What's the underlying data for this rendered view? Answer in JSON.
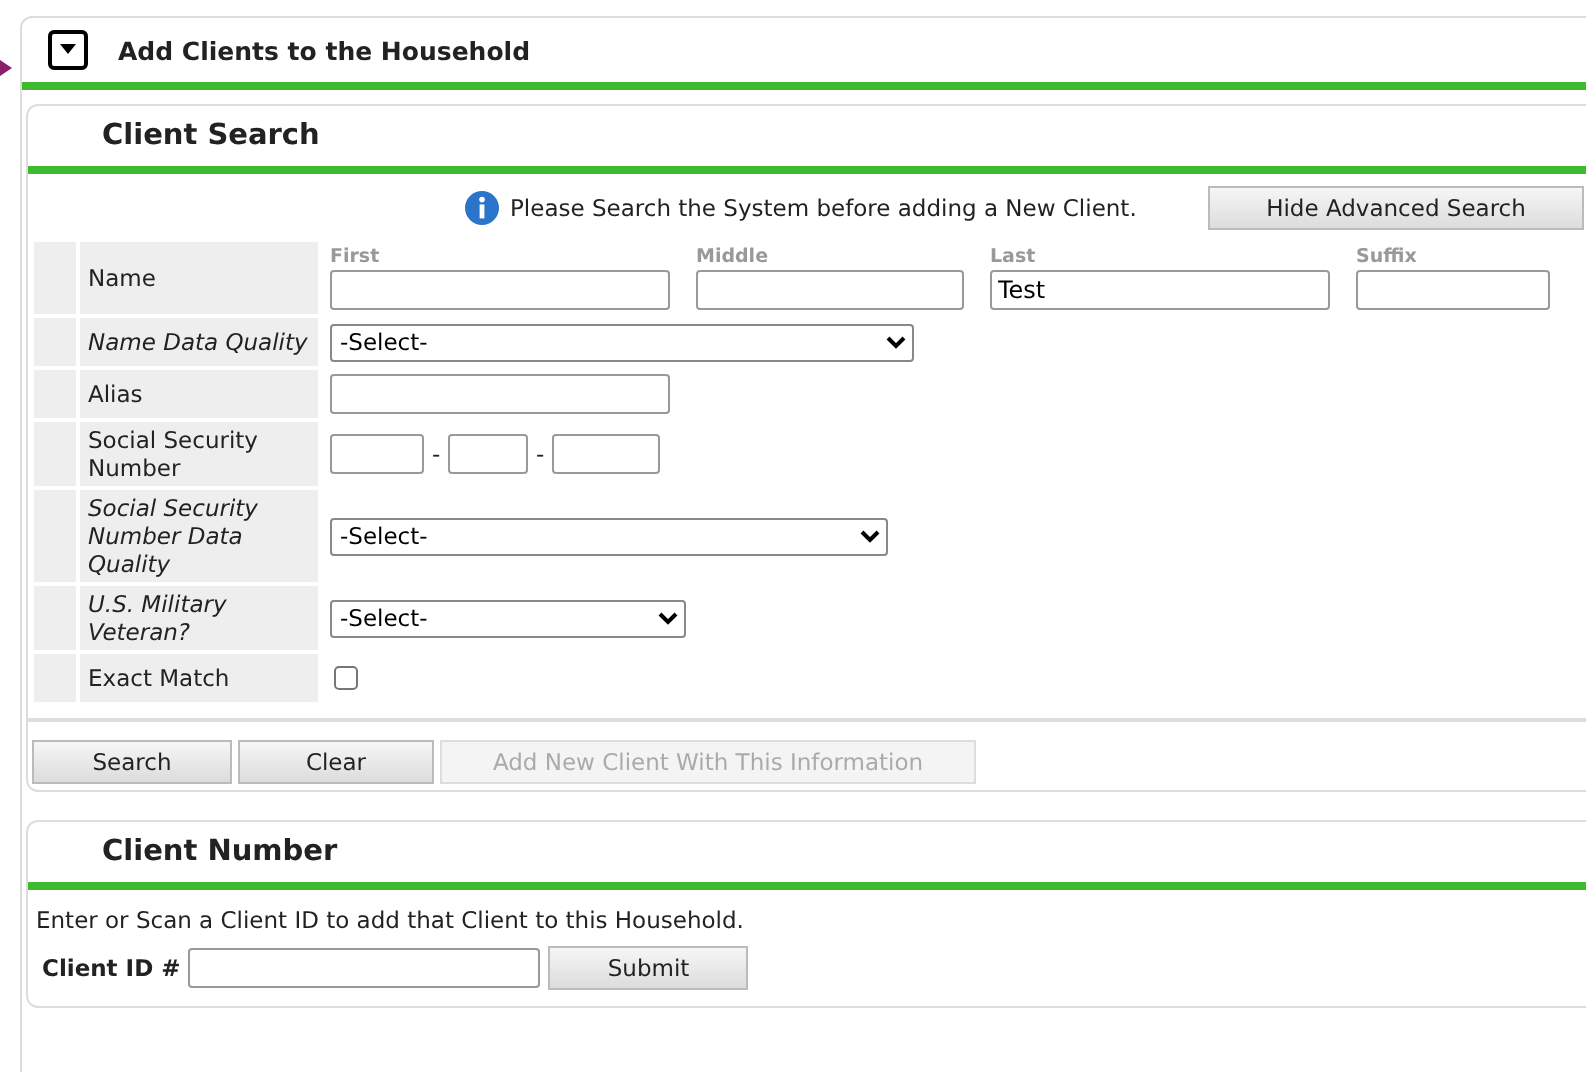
{
  "section": {
    "title": "Add Clients to the Household",
    "expanded": true
  },
  "client_search": {
    "title": "Client Search",
    "notice": "Please Search the System before adding a New Client.",
    "toggle_button": "Hide Advanced Search",
    "rows": [
      {
        "kind": "name",
        "label": "Name",
        "italic": false,
        "parts": [
          {
            "caption": "First"
          },
          {
            "caption": "Middle"
          },
          {
            "caption": "Last",
            "value": "Test"
          },
          {
            "caption": "Suffix"
          }
        ]
      },
      {
        "kind": "select",
        "label": "Name Data Quality",
        "italic": true,
        "value": "-Select-"
      },
      {
        "kind": "text",
        "label": "Alias",
        "italic": false
      },
      {
        "kind": "ssn",
        "label": "Social Security Number",
        "italic": false,
        "separator": "-"
      },
      {
        "kind": "select",
        "label": "Social Security Number Data Quality",
        "italic": true,
        "value": "-Select-"
      },
      {
        "kind": "select",
        "label": "U.S. Military Veteran?",
        "italic": true,
        "value": "-Select-"
      },
      {
        "kind": "checkbox",
        "label": "Exact Match",
        "italic": false,
        "checked": false
      }
    ],
    "buttons": [
      {
        "label": "Search",
        "disabled": false
      },
      {
        "label": "Clear",
        "disabled": false
      },
      {
        "label": "Add New Client With This Information",
        "disabled": true
      }
    ]
  },
  "client_number": {
    "title": "Client Number",
    "instructions": "Enter or Scan a Client ID to add that Client to this Household.",
    "field_label": "Client ID #",
    "button": "Submit"
  }
}
